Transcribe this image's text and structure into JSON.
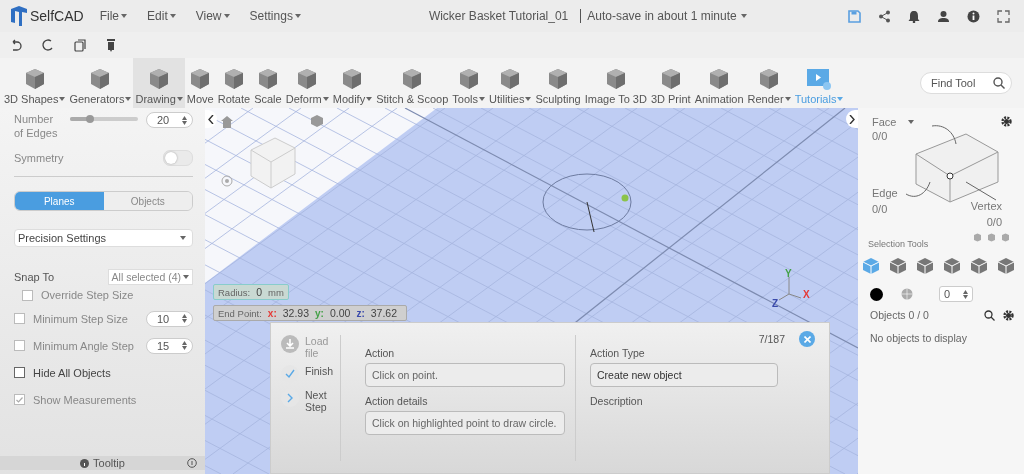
{
  "app": {
    "name": "SelfCAD"
  },
  "menu": [
    {
      "label": "File"
    },
    {
      "label": "Edit"
    },
    {
      "label": "View"
    },
    {
      "label": "Settings"
    }
  ],
  "document": {
    "title": "Wicker Basket Tutorial_01",
    "autosave": "Auto-save in about 1 minute"
  },
  "toolbar": {
    "tools": [
      {
        "label": "3D Shapes",
        "has_menu": true,
        "selected": false,
        "highlighted": false
      },
      {
        "label": "Generators",
        "has_menu": true,
        "selected": false,
        "highlighted": false
      },
      {
        "label": "Drawing",
        "has_menu": true,
        "selected": true,
        "highlighted": false
      },
      {
        "label": "Move",
        "has_menu": false,
        "selected": false,
        "highlighted": false
      },
      {
        "label": "Rotate",
        "has_menu": false,
        "selected": false,
        "highlighted": false
      },
      {
        "label": "Scale",
        "has_menu": false,
        "selected": false,
        "highlighted": false
      },
      {
        "label": "Deform",
        "has_menu": true,
        "selected": false,
        "highlighted": false
      },
      {
        "label": "Modify",
        "has_menu": true,
        "selected": false,
        "highlighted": false
      },
      {
        "label": "Stitch & Scoop",
        "has_menu": false,
        "selected": false,
        "highlighted": false
      },
      {
        "label": "Tools",
        "has_menu": true,
        "selected": false,
        "highlighted": false
      },
      {
        "label": "Utilities",
        "has_menu": true,
        "selected": false,
        "highlighted": false
      },
      {
        "label": "Sculpting",
        "has_menu": false,
        "selected": false,
        "highlighted": false
      },
      {
        "label": "Image To 3D",
        "has_menu": false,
        "selected": false,
        "highlighted": false
      },
      {
        "label": "3D Print",
        "has_menu": false,
        "selected": false,
        "highlighted": false
      },
      {
        "label": "Animation",
        "has_menu": false,
        "selected": false,
        "highlighted": false
      },
      {
        "label": "Render",
        "has_menu": true,
        "selected": false,
        "highlighted": false
      },
      {
        "label": "Tutorials",
        "has_menu": true,
        "selected": false,
        "highlighted": true
      }
    ],
    "search": {
      "placeholder": "Find Tool"
    }
  },
  "left_panel": {
    "edges": {
      "label": "Number of Edges",
      "level": 0.3,
      "value": "20"
    },
    "symmetry": {
      "label": "Symmetry",
      "on": false
    },
    "mode_tabs": [
      {
        "label": "Planes",
        "selected": true
      },
      {
        "label": "Objects",
        "selected": false
      }
    ],
    "precision": {
      "value": "Precision Settings"
    },
    "snap": {
      "label": "Snap To",
      "value": "All selected (4)"
    },
    "options": [
      {
        "kind": "sub",
        "label": "Override Step Size",
        "checked": false,
        "disabled": true
      },
      {
        "kind": "spin",
        "label": "Minimum Step Size",
        "checked": false,
        "disabled": true,
        "value": "10"
      },
      {
        "kind": "spin",
        "label": "Minimum Angle Step",
        "checked": false,
        "disabled": true,
        "value": "15"
      },
      {
        "kind": "plain",
        "label": "Hide All Objects",
        "checked": false,
        "disabled": false
      },
      {
        "kind": "plain",
        "label": "Show Measurements",
        "checked": true,
        "disabled": true
      }
    ],
    "footer": {
      "label": "Tooltip"
    }
  },
  "viewport": {
    "radius": {
      "label": "Radius:",
      "value": "0",
      "unit": "mm"
    },
    "end_point": {
      "label": "End Point:",
      "coords": [
        {
          "axis": "x:",
          "value": "32.93",
          "color": "#e53935"
        },
        {
          "axis": "y:",
          "value": "0.00",
          "color": "#43a047"
        },
        {
          "axis": "z:",
          "value": "37.62",
          "color": "#3949ab"
        }
      ]
    },
    "axes": [
      {
        "label": "Y",
        "color": "#43a047"
      },
      {
        "label": "X",
        "color": "#e53935"
      },
      {
        "label": "Z",
        "color": "#3949ab"
      }
    ]
  },
  "tutorial": {
    "steps": [
      {
        "kind": "load",
        "label": "Load file",
        "disabled": true
      },
      {
        "kind": "finish",
        "label": "Finish",
        "disabled": false
      },
      {
        "kind": "next",
        "label": "Next Step",
        "disabled": false
      }
    ],
    "counter": "7/187",
    "left_fields": [
      {
        "label": "Action",
        "value": "Click on point."
      },
      {
        "label": "Action details",
        "value": "Click on highlighted point to draw circle."
      }
    ],
    "right_fields": [
      {
        "label": "Action Type",
        "value": "Create new object"
      },
      {
        "label": "Description"
      }
    ]
  },
  "right_panel": {
    "face": {
      "label": "Face",
      "count": "0/0"
    },
    "edge": {
      "label": "Edge",
      "count": "0/0"
    },
    "vertex": {
      "label": "Vertex",
      "count": "0/0"
    },
    "selection_tools": {
      "label": "Selection Tools",
      "modes": [
        {
          "selected": true
        },
        {
          "selected": false
        },
        {
          "selected": false
        },
        {
          "selected": false
        },
        {
          "selected": false
        },
        {
          "selected": false
        }
      ]
    },
    "spinner": {
      "value": "0"
    },
    "objects": {
      "title": "Objects 0 / 0",
      "empty": "No objects to display"
    }
  }
}
